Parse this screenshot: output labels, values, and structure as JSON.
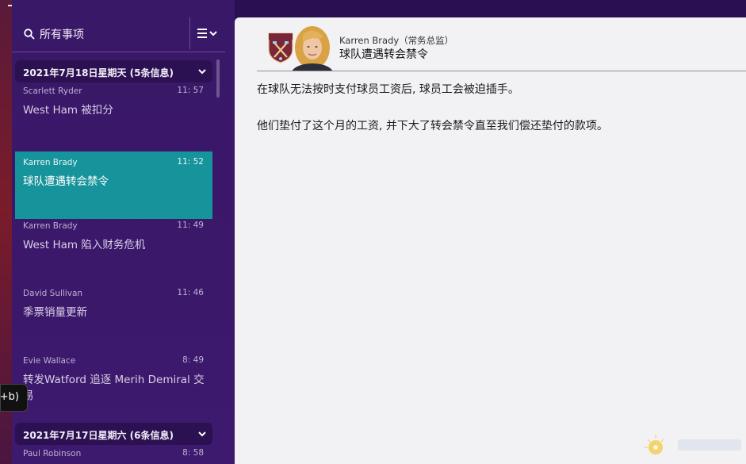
{
  "sidebar": {
    "search_label": "所有事项",
    "groups": [
      {
        "date_label": "2021年7月18日星期天 (5条信息)"
      },
      {
        "date_label": "2021年7月17日星期六 (6条信息)"
      }
    ],
    "messages": [
      {
        "sender": "Scarlett Ryder",
        "time": "11: 57",
        "subject": "West Ham 被扣分"
      },
      {
        "sender": "Karren Brady",
        "time": "11: 52",
        "subject": "球队遭遇转会禁令"
      },
      {
        "sender": "Karren Brady",
        "time": "11: 49",
        "subject": "West Ham 陷入财务危机"
      },
      {
        "sender": "David Sullivan",
        "time": "11: 46",
        "subject": "季票销量更新"
      },
      {
        "sender": "Evie Wallace",
        "time": "8: 49",
        "subject": "转发Watford 追逐 Merih Demiral 交易"
      },
      {
        "sender": "Paul Robinson",
        "time": "8: 58",
        "subject": ""
      }
    ]
  },
  "tooltip": {
    "text": "+b)"
  },
  "detail": {
    "sender": "Karren Brady（常务总监）",
    "title": "球队遭遇转会禁令",
    "paragraphs": [
      "在球队无法按时支付球员工资后, 球员工会被迫插手。",
      "他们垫付了这个月的工资, 并下大了转会禁令直至我们偿还垫付的款项。"
    ]
  },
  "colors": {
    "sidebar_bg": "#3b1769",
    "selected_bg": "#17939b",
    "content_bg": "#f2f1f4"
  }
}
